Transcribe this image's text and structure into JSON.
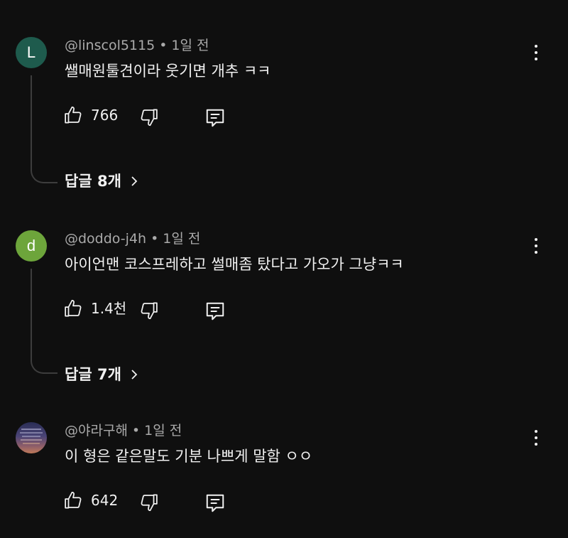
{
  "comments": [
    {
      "avatar_letter": "L",
      "avatar_color": "#1e5b4d",
      "author": "@linscol5115",
      "separator": "•",
      "time": "1일 전",
      "text": "쌜매원툴견이라 웃기면 개추 ㅋㅋ",
      "likes": "766",
      "replies_label": "답글 8개"
    },
    {
      "avatar_letter": "d",
      "avatar_color": "#6da53b",
      "author": "@doddo-j4h",
      "separator": "•",
      "time": "1일 전",
      "text": "아이언맨 코스프레하고 썰매좀 탔다고 가오가 그냥ㅋㅋ",
      "likes": "1.4천",
      "replies_label": "답글 7개"
    },
    {
      "avatar_letter": "",
      "avatar_color": "#3c3f6e",
      "author": "@야라구해",
      "separator": "•",
      "time": "1일 전",
      "text": "이 형은 같은말도 기분 나쁘게 말함 ㅇㅇ",
      "likes": "642",
      "replies_label": ""
    }
  ],
  "icons": {
    "like": "thumbs-up-icon",
    "dislike": "thumbs-down-icon",
    "reply": "reply-comment-icon",
    "more": "more-vertical-icon",
    "chevron": "chevron-right-icon"
  }
}
